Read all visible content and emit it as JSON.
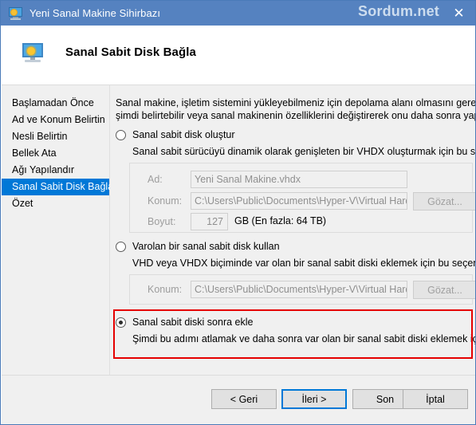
{
  "window": {
    "title": "Yeni Sanal Makine Sihirbazı",
    "watermark": "Sordum.net",
    "close_icon": "✕",
    "title_icon": "monitor-icon",
    "accent_color": "#5582c0",
    "selection_color": "#0078d7",
    "annotation_color": "#e50000"
  },
  "header": {
    "title": "Sanal Sabit Disk Bağla",
    "icon": "monitor-icon"
  },
  "sidebar": {
    "items": [
      {
        "label": "Başlamadan Önce",
        "selected": false
      },
      {
        "label": "Ad ve Konum Belirtin",
        "selected": false
      },
      {
        "label": "Nesli Belirtin",
        "selected": false
      },
      {
        "label": "Bellek Ata",
        "selected": false
      },
      {
        "label": "Ağı Yapılandır",
        "selected": false
      },
      {
        "label": "Sanal Sabit Disk Bağla",
        "selected": true
      },
      {
        "label": "Özet",
        "selected": false
      }
    ]
  },
  "main": {
    "intro_line1": "Sanal makine, işletim sistemini yükleyebilmeniz için depolama alanı olmasını gerektirir. Depolama",
    "intro_line2": "şimdi belirtebilir veya sanal makinenin özelliklerini değiştirerek onu daha sonra yapılandırabilirsin",
    "options": [
      {
        "label": "Sanal sabit disk oluştur",
        "selected": false,
        "description": "Sanal sabit sürücüyü dinamik olarak genişleten bir VHDX oluşturmak için bu seçeneği kullanı"
      },
      {
        "label": "Varolan bir sanal sabit disk kullan",
        "selected": false,
        "description": "VHD veya VHDX biçiminde var olan bir sanal sabit diski eklemek için bu seçeneği kullanın."
      },
      {
        "label": "Sanal sabit diski sonra ekle",
        "selected": true,
        "description": "Şimdi bu adımı atlamak ve daha sonra var olan bir sanal sabit diski eklemek için bu seçeneğ"
      }
    ],
    "create_group": {
      "name_label": "Ad:",
      "name_value": "Yeni Sanal Makine.vhdx",
      "location_label": "Konum:",
      "location_value": "C:\\Users\\Public\\Documents\\Hyper-V\\Virtual Hard Disks\\",
      "browse_label": "Gözat...",
      "size_label": "Boyut:",
      "size_value": "127",
      "size_unit": "GB (En fazla: 64 TB)"
    },
    "existing_group": {
      "location_label": "Konum:",
      "location_value": "C:\\Users\\Public\\Documents\\Hyper-V\\Virtual Hard Disks\\",
      "browse_label": "Gözat..."
    }
  },
  "footer": {
    "back": "< Geri",
    "next": "İleri >",
    "finish": "Son",
    "cancel": "İptal"
  }
}
